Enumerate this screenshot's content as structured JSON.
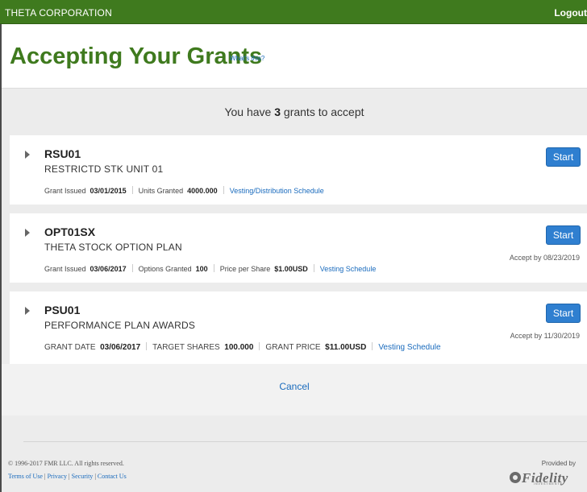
{
  "topbar": {
    "company": "THETA CORPORATION",
    "logout": "Logout"
  },
  "header": {
    "title": "Accepting Your Grants",
    "whats_this": "What's this?"
  },
  "summary": {
    "prefix": "You have",
    "count": "3",
    "suffix": "grants to accept"
  },
  "grants": [
    {
      "code": "RSU01",
      "description": "RESTRICTD STK UNIT 01",
      "fields": [
        {
          "label": "Grant Issued",
          "value": "03/01/2015"
        },
        {
          "label": "Units Granted",
          "value": "4000.000"
        }
      ],
      "link": "Vesting/Distribution Schedule",
      "button": "Start",
      "accept_by": ""
    },
    {
      "code": "OPT01SX",
      "description": "THETA STOCK OPTION PLAN",
      "fields": [
        {
          "label": "Grant Issued",
          "value": "03/06/2017"
        },
        {
          "label": "Options Granted",
          "value": "100"
        },
        {
          "label": "Price per Share",
          "value": "$1.00USD"
        }
      ],
      "link": "Vesting Schedule",
      "button": "Start",
      "accept_by": "Accept by 08/23/2019"
    },
    {
      "code": "PSU01",
      "description": "PERFORMANCE PLAN AWARDS",
      "fields": [
        {
          "label": "GRANT DATE",
          "value": "03/06/2017"
        },
        {
          "label": "TARGET SHARES",
          "value": "100.000"
        },
        {
          "label": "GRANT PRICE",
          "value": "$11.00USD"
        }
      ],
      "link": "Vesting Schedule",
      "button": "Start",
      "accept_by": "Accept by 11/30/2019"
    }
  ],
  "cancel": "Cancel",
  "footer": {
    "copyright": "© 1996-2017 FMR LLC.  All rights reserved.",
    "links": [
      "Terms of Use",
      "Privacy",
      "Security",
      "Contact Us"
    ],
    "separator": "|",
    "provided_by": "Provided by",
    "logo_text": "Fidelity",
    "logo_subtext": "INVESTMENTS"
  },
  "colors": {
    "brand_green": "#3f7a1e",
    "button_blue": "#2f7fd0",
    "link_blue": "#1a6bbd"
  },
  "icons": {
    "expand": "caret-right-icon",
    "logo": "fidelity-logo"
  }
}
